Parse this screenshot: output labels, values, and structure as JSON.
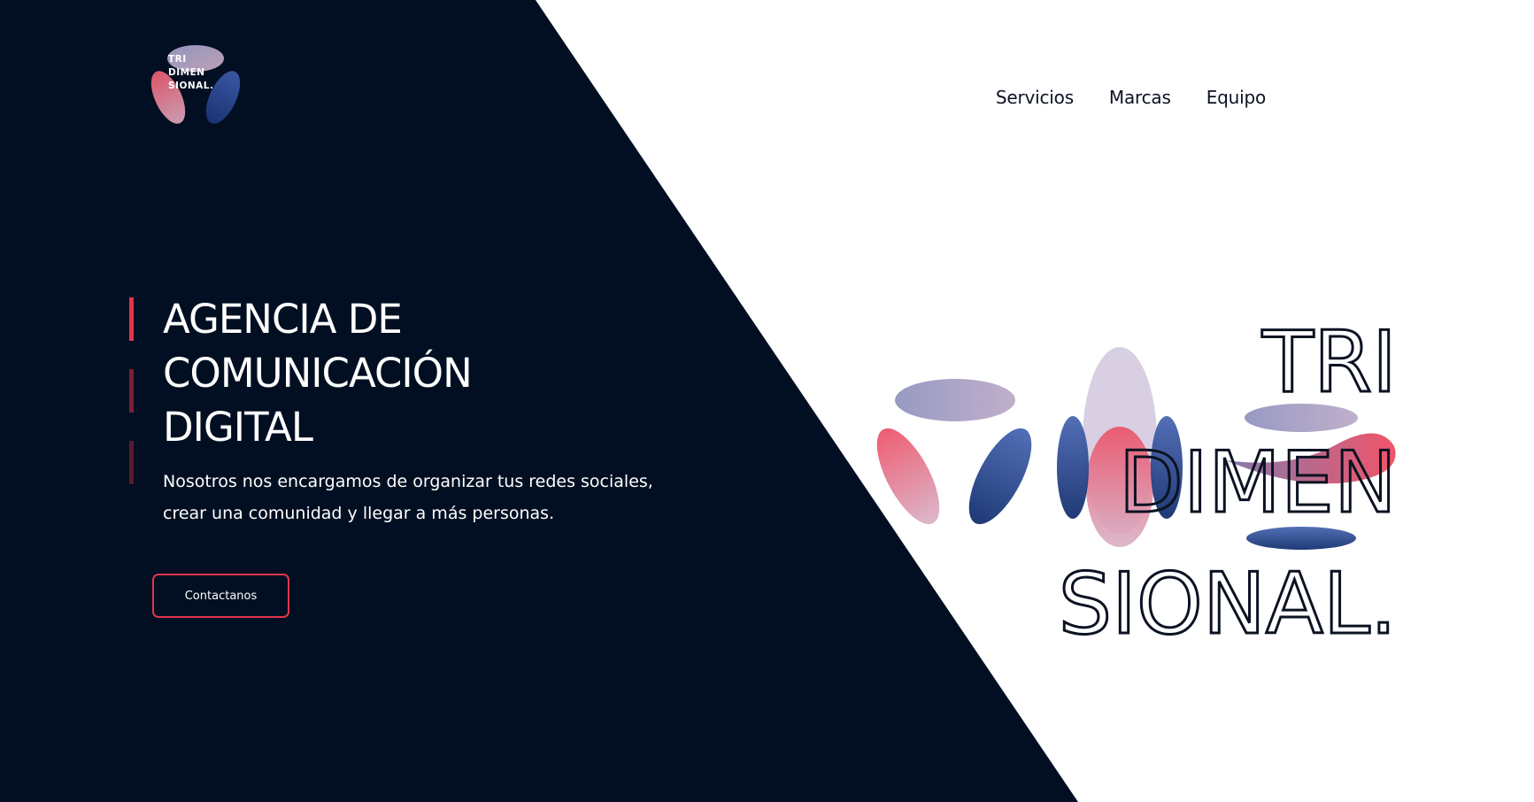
{
  "brand": {
    "logo_lines": [
      "TRI",
      "DIMEN",
      "SIONAL."
    ]
  },
  "nav": {
    "items": [
      {
        "label": "Servicios"
      },
      {
        "label": "Marcas"
      },
      {
        "label": "Equipo"
      }
    ]
  },
  "hero": {
    "title_lines": [
      "AGENCIA DE",
      "COMUNICACIÓN",
      "DIGITAL"
    ],
    "subtitle_lines": [
      "Nosotros nos encargamos de organizar tus redes sociales,",
      "crear una comunidad y llegar a más personas."
    ],
    "cta_label": "Contactanos"
  },
  "big_logo": {
    "lines": [
      "TRI",
      "DIMEN",
      "SIONAL."
    ]
  },
  "colors": {
    "dark_bg": "#020f22",
    "accent_red": "#e0364b",
    "accent_blue": "#1f3f82",
    "lavender": "#8d8fb8",
    "white": "#ffffff"
  }
}
